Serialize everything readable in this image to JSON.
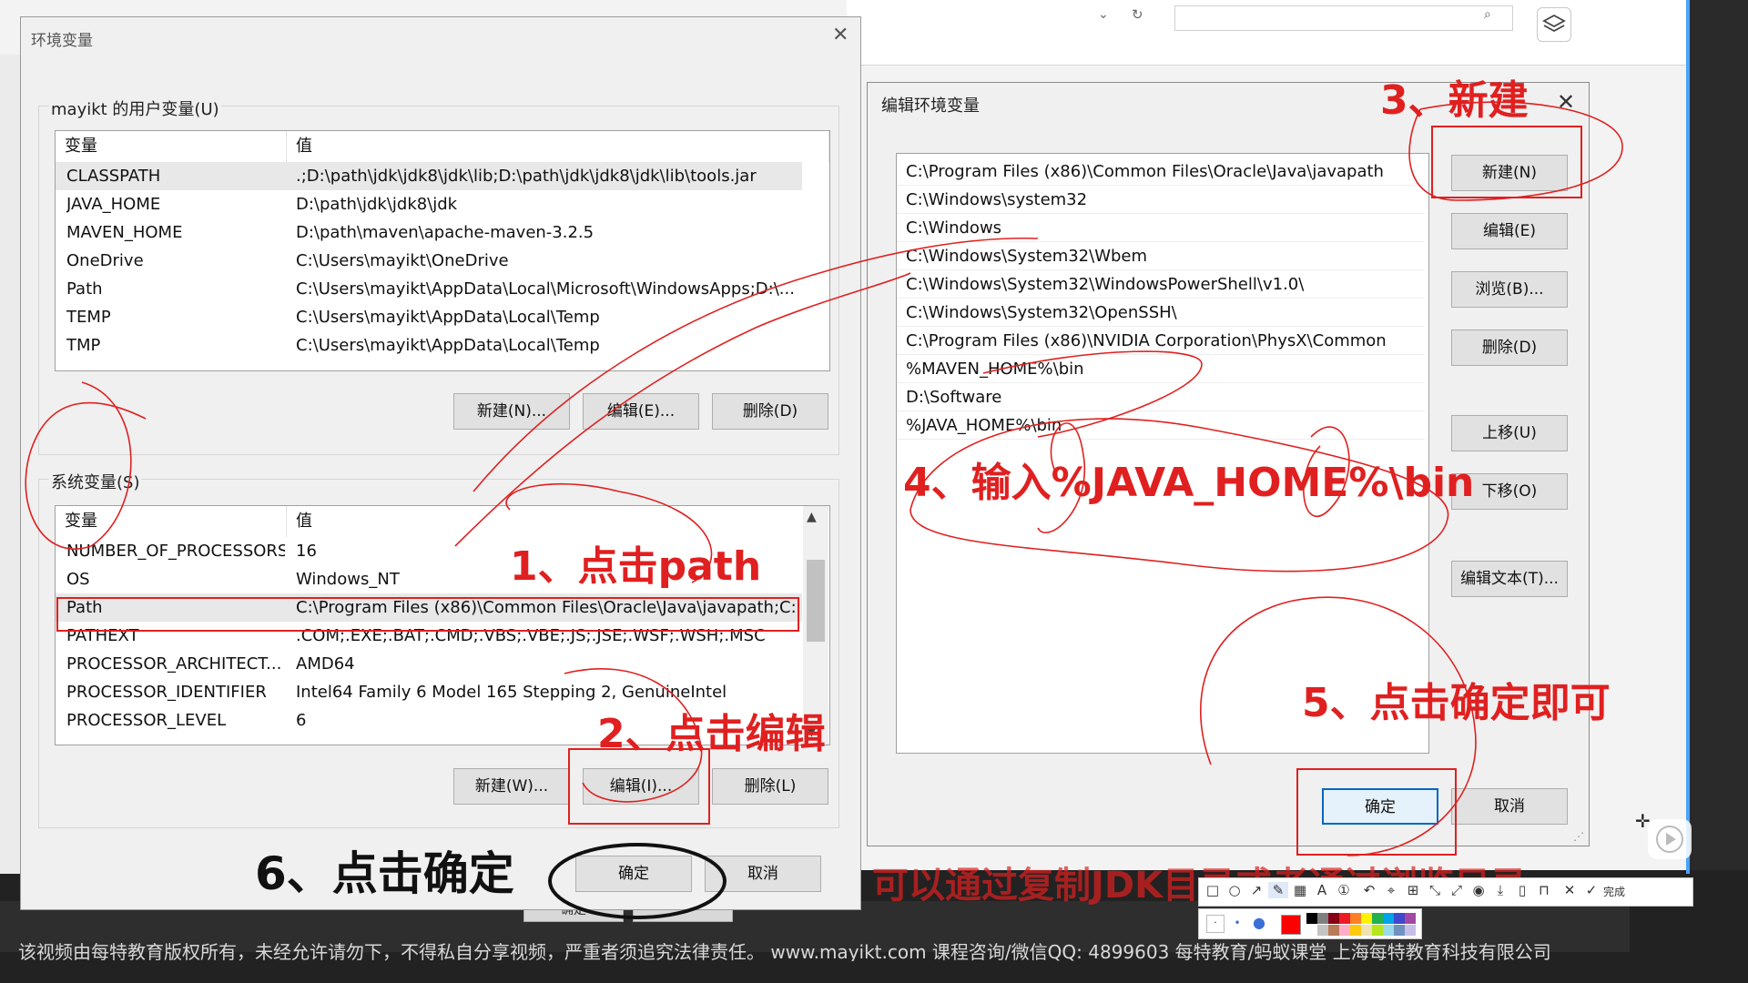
{
  "env_dialog": {
    "title": "环境变量",
    "close": "✕",
    "user_group_label": "mayikt 的用户变量(U)",
    "sys_group_label": "系统变量(S)",
    "col_name": "变量",
    "col_value": "值",
    "user_vars": [
      {
        "name": "CLASSPATH",
        "value": ".;D:\\path\\jdk\\jdk8\\jdk\\lib;D:\\path\\jdk\\jdk8\\jdk\\lib\\tools.jar"
      },
      {
        "name": "JAVA_HOME",
        "value": "D:\\path\\jdk\\jdk8\\jdk"
      },
      {
        "name": "MAVEN_HOME",
        "value": "D:\\path\\maven\\apache-maven-3.2.5"
      },
      {
        "name": "OneDrive",
        "value": "C:\\Users\\mayikt\\OneDrive"
      },
      {
        "name": "Path",
        "value": "C:\\Users\\mayikt\\AppData\\Local\\Microsoft\\WindowsApps;D:\\..."
      },
      {
        "name": "TEMP",
        "value": "C:\\Users\\mayikt\\AppData\\Local\\Temp"
      },
      {
        "name": "TMP",
        "value": "C:\\Users\\mayikt\\AppData\\Local\\Temp"
      }
    ],
    "sys_vars": [
      {
        "name": "NUMBER_OF_PROCESSORS",
        "value": "16"
      },
      {
        "name": "OS",
        "value": "Windows_NT"
      },
      {
        "name": "Path",
        "value": "C:\\Program Files (x86)\\Common Files\\Oracle\\Java\\javapath;C:..."
      },
      {
        "name": "PATHEXT",
        "value": ".COM;.EXE;.BAT;.CMD;.VBS;.VBE;.JS;.JSE;.WSF;.WSH;.MSC"
      },
      {
        "name": "PROCESSOR_ARCHITECT...",
        "value": "AMD64"
      },
      {
        "name": "PROCESSOR_IDENTIFIER",
        "value": "Intel64 Family 6 Model 165 Stepping 2, GenuineIntel"
      },
      {
        "name": "PROCESSOR_LEVEL",
        "value": "6"
      }
    ],
    "user_buttons": {
      "new": "新建(N)...",
      "edit": "编辑(E)...",
      "delete": "删除(D)"
    },
    "sys_buttons": {
      "new": "新建(W)...",
      "edit": "编辑(I)...",
      "delete": "删除(L)"
    },
    "ok": "确定",
    "cancel": "取消"
  },
  "edit_dialog": {
    "title": "编辑环境变量",
    "close": "✕",
    "entries": [
      "C:\\Program Files (x86)\\Common Files\\Oracle\\Java\\javapath",
      "C:\\Windows\\system32",
      "C:\\Windows",
      "C:\\Windows\\System32\\Wbem",
      "C:\\Windows\\System32\\WindowsPowerShell\\v1.0\\",
      "C:\\Windows\\System32\\OpenSSH\\",
      "C:\\Program Files (x86)\\NVIDIA Corporation\\PhysX\\Common",
      "%MAVEN_HOME%\\bin",
      "D:\\Software",
      "%JAVA_HOME%\\bin"
    ],
    "buttons": {
      "new": "新建(N)",
      "edit": "编辑(E)",
      "browse": "浏览(B)...",
      "delete": "删除(D)",
      "move_up": "上移(U)",
      "move_down": "下移(O)",
      "edit_text": "编辑文本(T)..."
    },
    "ok": "确定",
    "cancel": "取消"
  },
  "annotations": {
    "step1": "1、点击path",
    "step2": "2、点击编辑",
    "step3": "3、新建",
    "step4": "4、输入%JAVA_HOME%\\bin",
    "step5": "5、点击确定即可",
    "step6": "6、点击确定"
  },
  "caption": "可以通过复制JDK目录或者通过浏览目录",
  "footer": "该视频由每特教育版权所有，未经允许请勿下，不得私自分享视频，严重者须追究法律责任。 www.mayikt.com 课程咨询/微信QQ: 4899603 每特教育/蚂蚁课堂 上海每特教育科技有限公司",
  "screenshot_toolbar": {
    "done": "完成",
    "colors": [
      "#ff0000",
      "#000000",
      "#7f7f7f",
      "#880015",
      "#ed1c24",
      "#ff7f27",
      "#fff200",
      "#22b14c",
      "#00a2e8",
      "#3f48cc",
      "#a349a4",
      "#ffffff",
      "#c3c3c3",
      "#b97a57",
      "#ffaec9",
      "#ffc90e",
      "#efe4b0",
      "#b5e61d",
      "#99d9ea",
      "#7092be",
      "#c8bfe7"
    ]
  },
  "bg_button": "确定",
  "colors": {
    "annotation": "#e02020",
    "accent": "#0067c0",
    "dialog_bg": "#f0f0f0"
  }
}
